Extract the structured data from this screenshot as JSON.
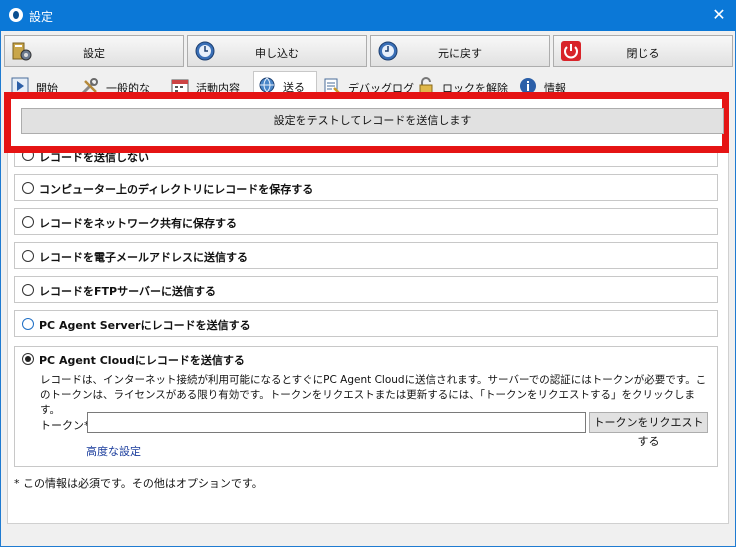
{
  "window": {
    "title": "設定",
    "close_symbol": "✕"
  },
  "toolbar": {
    "settings_label": "設定",
    "apply_label": "申し込む",
    "revert_label": "元に戻す",
    "close_label": "閉じる"
  },
  "tabs": [
    {
      "label": "開始"
    },
    {
      "label": "一般的な"
    },
    {
      "label": "活動内容"
    },
    {
      "label": "送る"
    },
    {
      "label": "デバッグログ"
    },
    {
      "label": "ロックを解除"
    },
    {
      "label": "情報"
    }
  ],
  "test_button_label": "設定をテストしてレコードを送信します",
  "options": [
    {
      "label": "レコードを送信しない"
    },
    {
      "label": "コンピューター上のディレクトリにレコードを保存する"
    },
    {
      "label": "レコードをネットワーク共有に保存する"
    },
    {
      "label": "レコードを電子メールアドレスに送信する"
    },
    {
      "label": "レコードをFTPサーバーに送信する"
    },
    {
      "label": "PC Agent Serverにレコードを送信する"
    }
  ],
  "cloud": {
    "label": "PC Agent Cloudにレコードを送信する",
    "description": "レコードは、インターネット接続が利用可能になるとすぐにPC Agent Cloudに送信されます。サーバーでの認証にはトークンが必要です。このトークンは、ライセンスがある限り有効です。トークンをリクエストまたは更新するには、「トークンをリクエストする」をクリックします。",
    "token_label": "トークン*:",
    "token_value": "",
    "request_token_label": "トークンをリクエストする",
    "advanced_link": "高度な設定"
  },
  "footnote": "* この情報は必須です。その他はオプションです。",
  "colors": {
    "titlebar": "#0b78d7",
    "highlight": "#e51414",
    "link": "#1a3c9c"
  }
}
